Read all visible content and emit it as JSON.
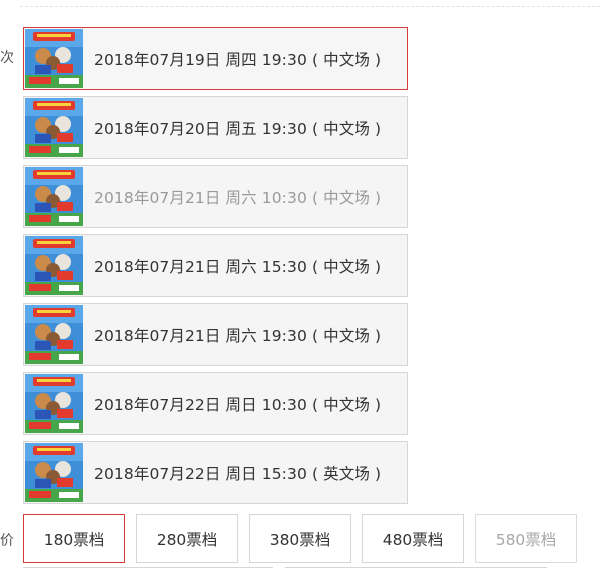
{
  "labels": {
    "session_row_label": "场次",
    "price_row_label": "票价"
  },
  "sessions": [
    {
      "label": "2018年07月19日 周四 19:30 ( 中文场 )",
      "state": "selected"
    },
    {
      "label": "2018年07月20日 周五 19:30 ( 中文场 )",
      "state": "normal"
    },
    {
      "label": "2018年07月21日 周六 10:30 ( 中文场 )",
      "state": "disabled"
    },
    {
      "label": "2018年07月21日 周六 15:30 ( 中文场 )",
      "state": "normal"
    },
    {
      "label": "2018年07月21日 周六 19:30 ( 中文场 )",
      "state": "normal"
    },
    {
      "label": "2018年07月22日 周日 10:30 ( 中文场 )",
      "state": "normal"
    },
    {
      "label": "2018年07月22日 周日 15:30 ( 英文场 )",
      "state": "normal"
    }
  ],
  "price_tiers": [
    {
      "label": "180票档",
      "state": "selected"
    },
    {
      "label": "280票档",
      "state": "normal"
    },
    {
      "label": "380票档",
      "state": "normal"
    },
    {
      "label": "480票档",
      "state": "normal"
    },
    {
      "label": "580票档",
      "state": "disabled"
    }
  ],
  "colors": {
    "accent": "#d73c3c",
    "border": "#d6d6d6",
    "disabled_text": "#9a9a9a"
  }
}
